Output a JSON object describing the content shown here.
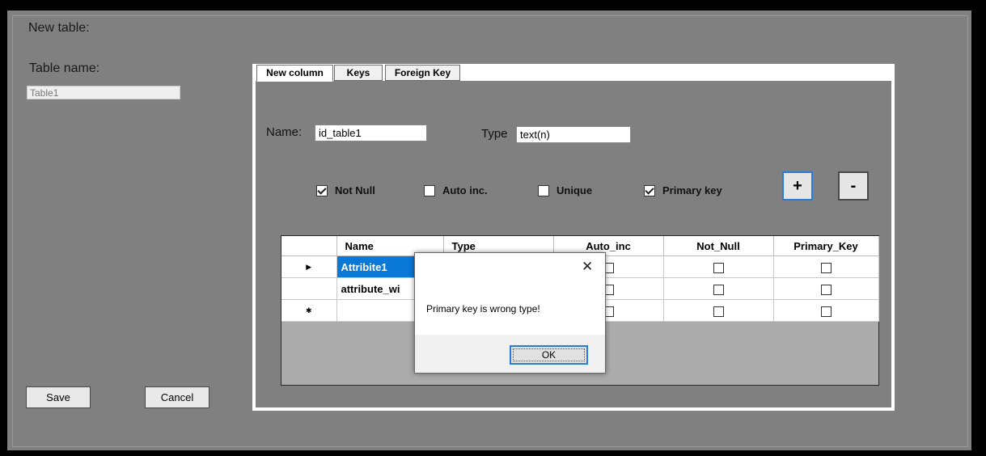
{
  "window": {
    "title": "New table:",
    "table_name_label": "Table name:",
    "table_name_value": "Table1",
    "save_label": "Save",
    "cancel_label": "Cancel"
  },
  "tabs": [
    {
      "label": "New column",
      "active": true
    },
    {
      "label": "Keys",
      "active": false
    },
    {
      "label": "Foreign Key",
      "active": false
    }
  ],
  "column_form": {
    "name_label": "Name:",
    "name_value": "id_table1",
    "type_label": "Type",
    "type_value": "text(n)",
    "checkboxes": [
      {
        "label": "Not Null",
        "checked": true
      },
      {
        "label": "Auto inc.",
        "checked": false
      },
      {
        "label": "Unique",
        "checked": false
      },
      {
        "label": "Primary key",
        "checked": true
      }
    ],
    "add_label": "+",
    "remove_label": "-"
  },
  "grid": {
    "headers": [
      "Name",
      "Type",
      "Auto_inc",
      "Not_Null",
      "Primary_Key"
    ],
    "rows": [
      {
        "indicator": "▶",
        "name": "Attribite1",
        "selected": true
      },
      {
        "indicator": "",
        "name": "attribute_wi",
        "selected": false
      },
      {
        "indicator": "✱",
        "name": "",
        "selected": false
      }
    ]
  },
  "dialog": {
    "close_glyph": "✕",
    "message": "Primary key is wrong type!",
    "ok_label": "OK"
  },
  "icons": {
    "close": "close-icon",
    "row_current": "row-pointer-icon",
    "row_new": "new-row-icon",
    "check": "check-icon"
  },
  "colors": {
    "window_bg": "#808080",
    "selection": "#0a78d7",
    "focus_border": "#2b7bd8"
  }
}
